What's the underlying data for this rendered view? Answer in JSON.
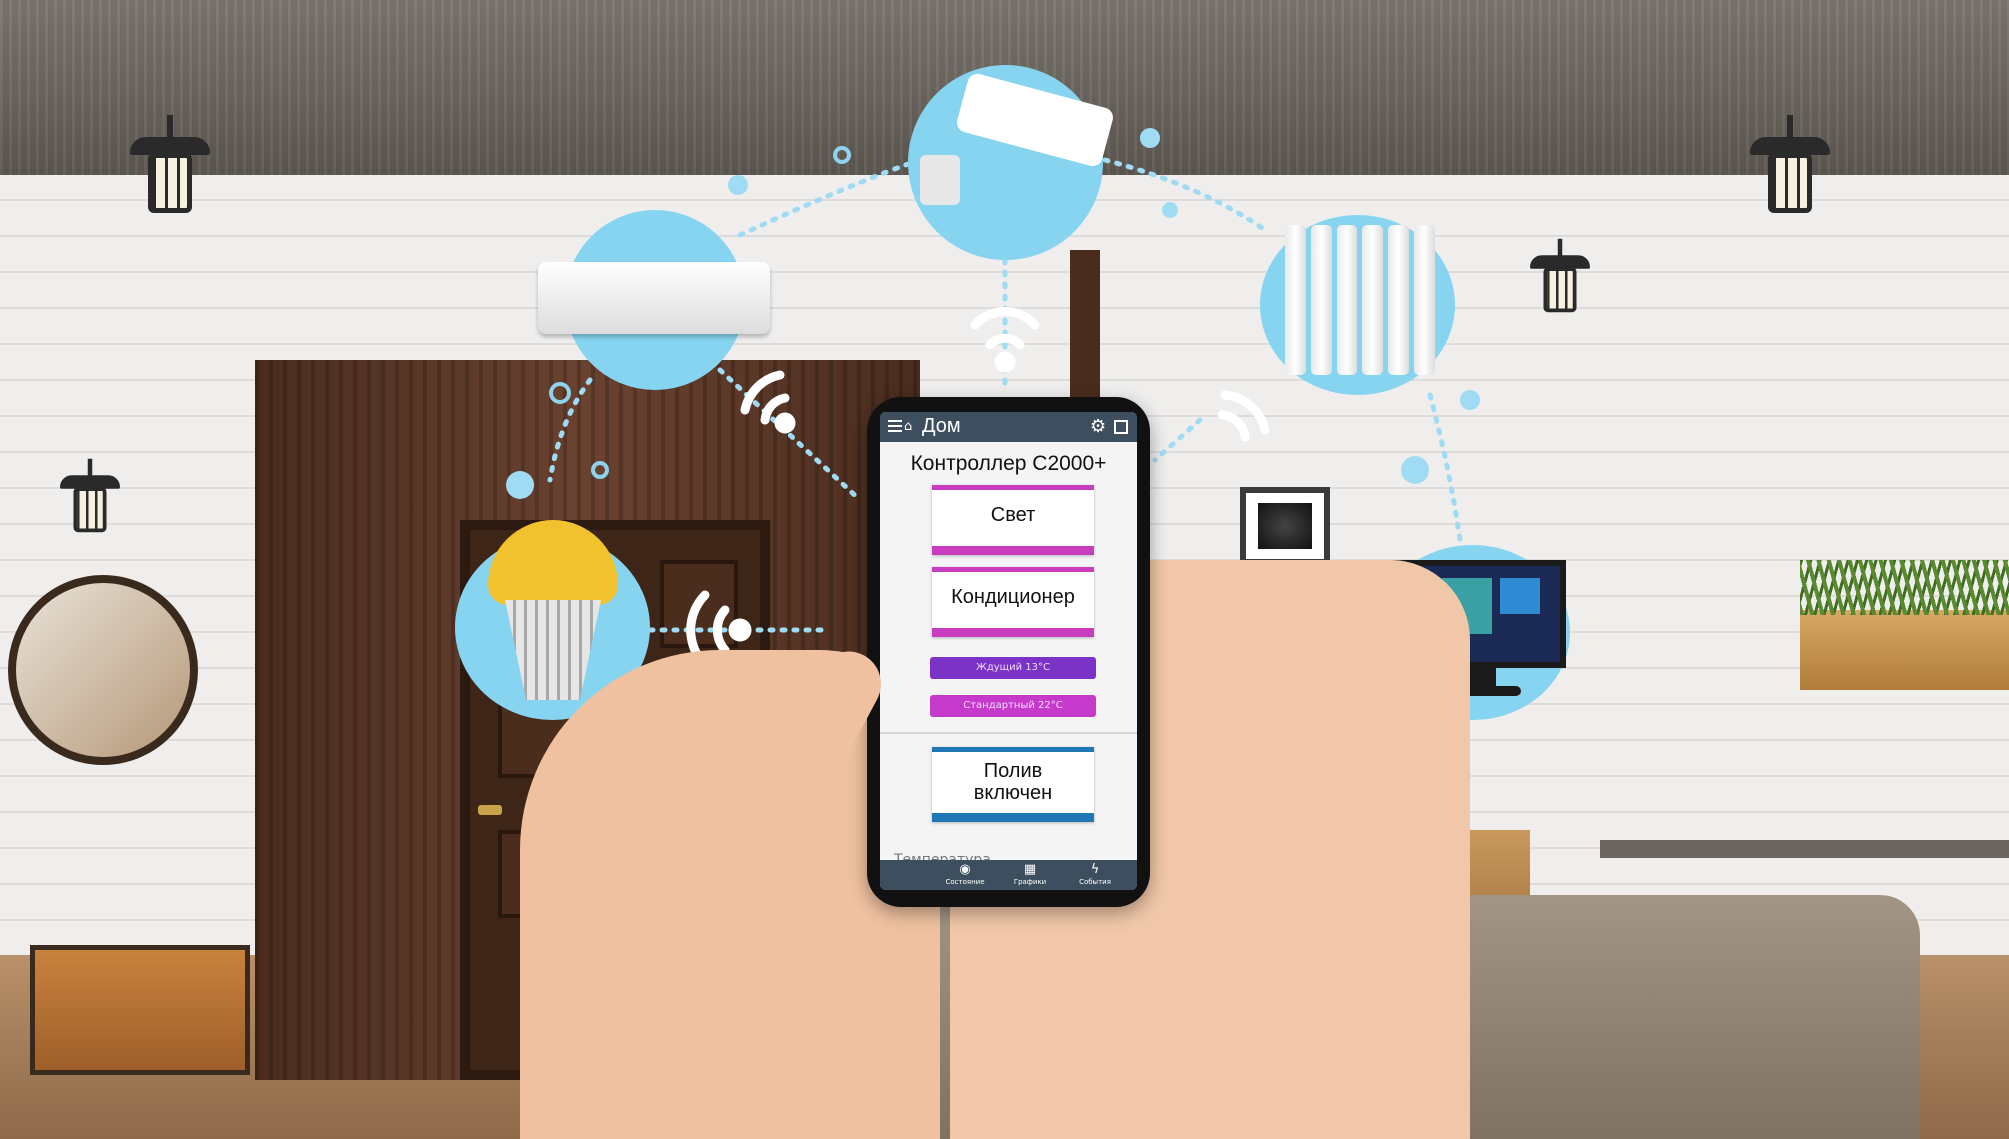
{
  "phone_app": {
    "header": {
      "title": "Дом",
      "menu_icon": "menu-icon",
      "home_icon": "home-icon",
      "settings_icon": "gear-icon",
      "save_icon": "save-icon"
    },
    "controller_title": "Контроллер С2000+",
    "tiles": {
      "light": "Свет",
      "air_conditioner": "Кондиционер",
      "watering_line1": "Полив",
      "watering_line2": "включен"
    },
    "modes": {
      "waiting": "Ждущий 13°C",
      "standard": "Стандартный 22°C"
    },
    "temperature_label": "Температура",
    "bottom_nav": [
      {
        "label": "Состояние",
        "icon": "status-icon"
      },
      {
        "label": "Графики",
        "icon": "charts-icon"
      },
      {
        "label": "События",
        "icon": "events-icon"
      }
    ]
  },
  "connected_devices": [
    "air-conditioner-icon",
    "security-camera-icon",
    "radiator-icon",
    "light-bulb-icon",
    "tv-monitor-icon"
  ],
  "colors": {
    "bubble": "#86d4f0",
    "app_header": "#3d4f5e",
    "tile_accent": "#c83dbd",
    "water_accent": "#1f78b4",
    "mode_waiting": "#7b32c6",
    "mode_standard": "#c63acb"
  }
}
